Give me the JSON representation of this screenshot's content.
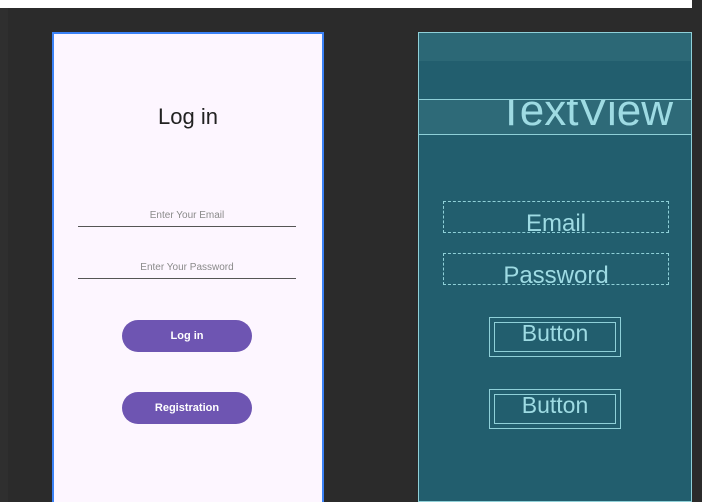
{
  "design_preview": {
    "title": "Log in",
    "email_placeholder": "Enter Your Email",
    "password_placeholder": "Enter Your Password",
    "login_button": "Log in",
    "registration_button": "Registration"
  },
  "blueprint_preview": {
    "textview_label": "TextView",
    "email_label": "Email",
    "password_label": "Password",
    "button_1_label": "Button",
    "button_2_label": "Button"
  },
  "colors": {
    "canvas": "#2b2b2b",
    "design_background": "#fdf6ff",
    "accent_purple": "#6e55b2",
    "blueprint_background": "#225e6e",
    "blueprint_line": "#8fd0d8"
  }
}
